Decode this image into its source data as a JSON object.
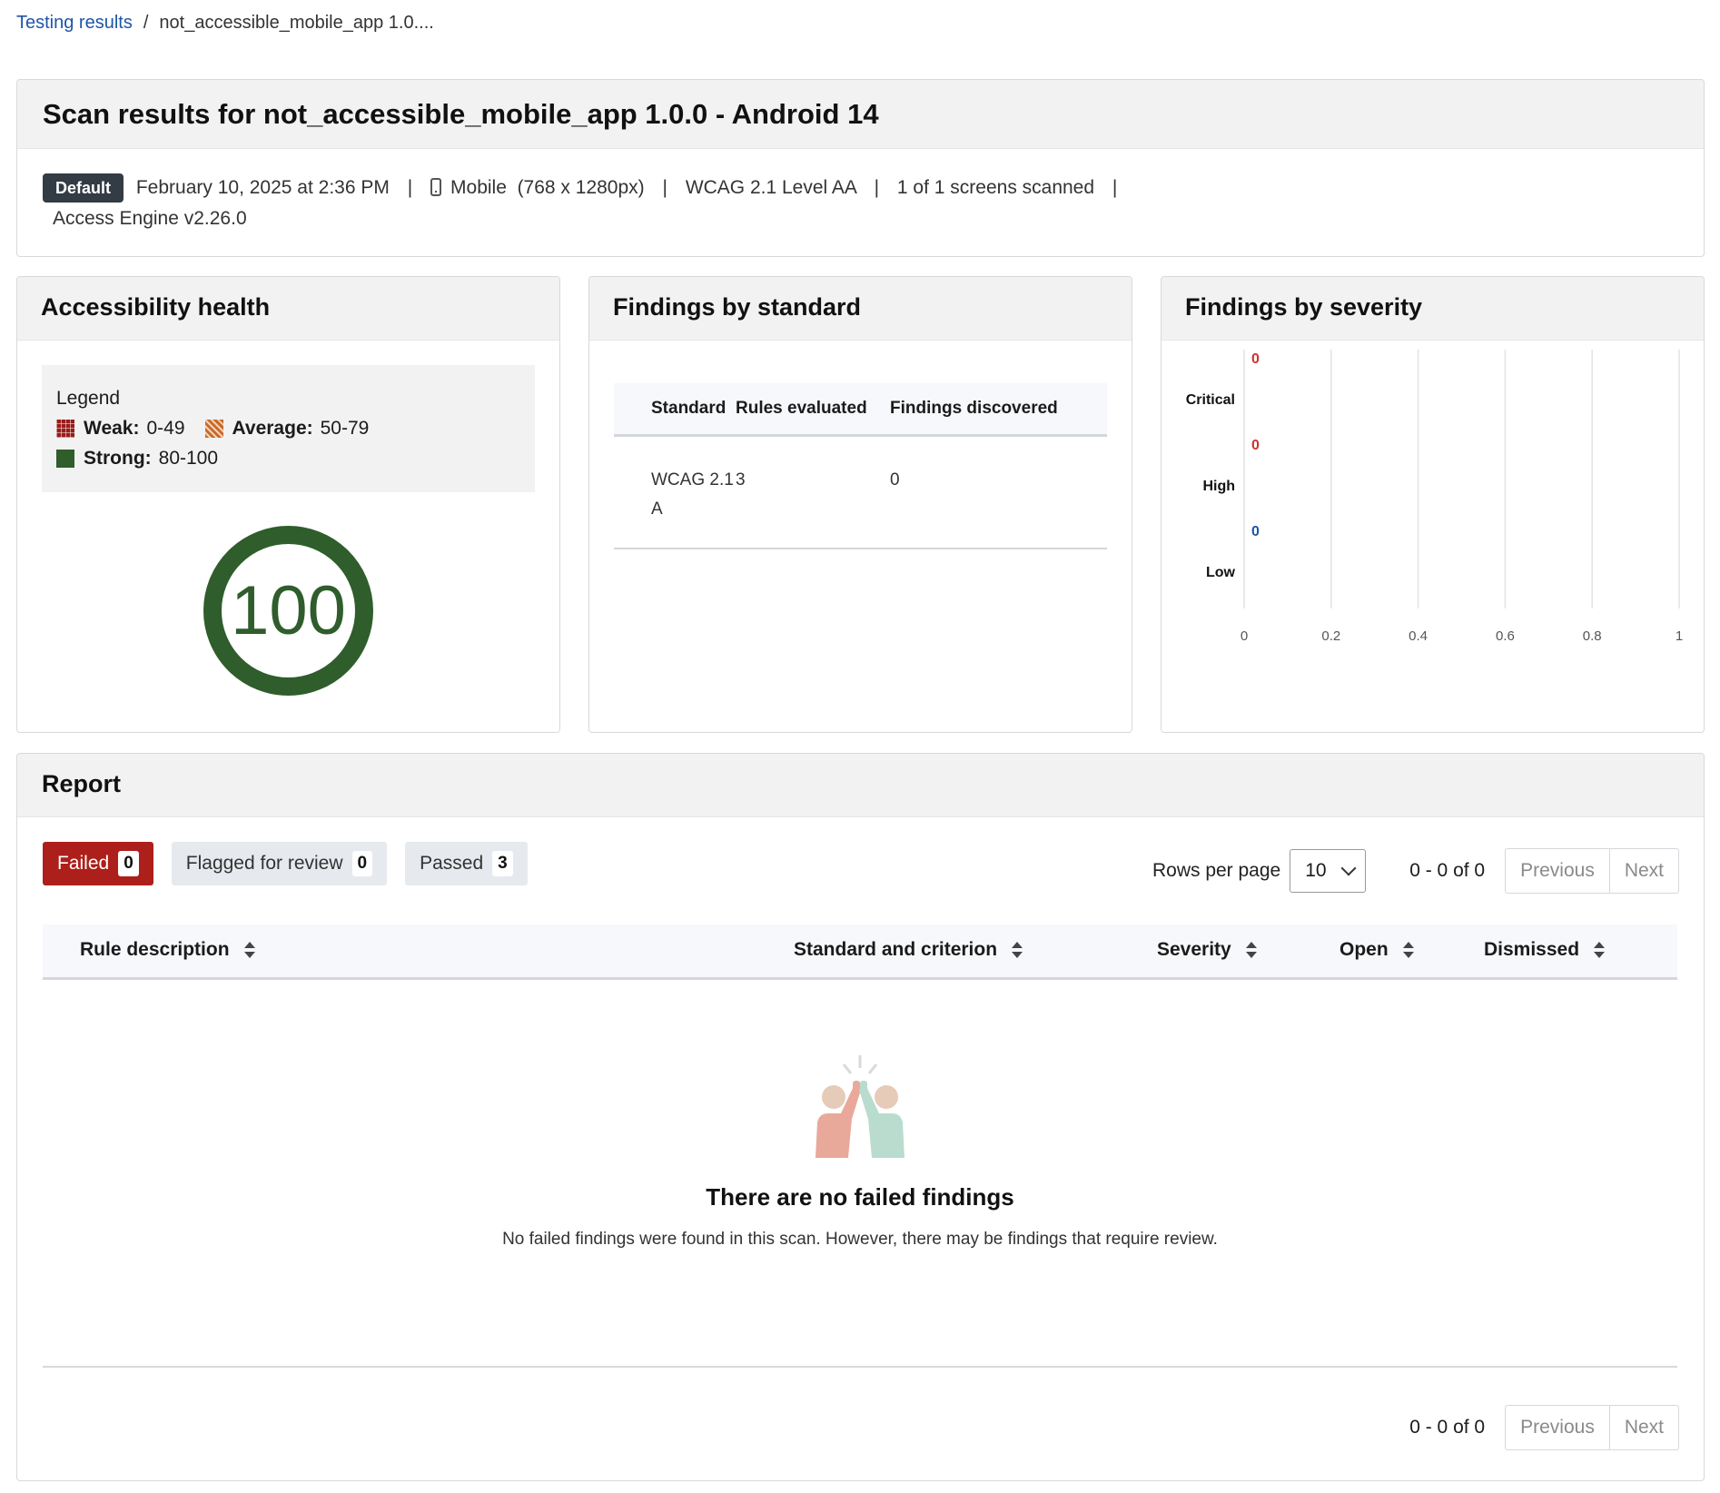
{
  "breadcrumb": {
    "link": "Testing results",
    "separator": "/",
    "current": "not_accessible_mobile_app 1.0...."
  },
  "header": {
    "title": "Scan results for not_accessible_mobile_app 1.0.0 - Android 14",
    "badge": "Default",
    "date": "February 10, 2025 at 2:36 PM",
    "device": "Mobile",
    "resolution": "(768 x 1280px)",
    "standard": "WCAG 2.1 Level AA",
    "screens": "1 of 1 screens scanned",
    "engine": "Access Engine v2.26.0",
    "separator": "|",
    "device_icon": "mobile-phone-icon"
  },
  "health": {
    "title": "Accessibility health",
    "legend_title": "Legend",
    "weak_label": "Weak:",
    "weak_range": "0-49",
    "average_label": "Average:",
    "average_range": "50-79",
    "strong_label": "Strong:",
    "strong_range": "80-100",
    "score": "100",
    "colors": {
      "weak": "#9b1b1b",
      "average": "#c76a2b",
      "strong": "#2f5d2c"
    }
  },
  "standard": {
    "title": "Findings by standard",
    "columns": [
      "Standard",
      "Rules evaluated",
      "Findings discovered"
    ],
    "rows": [
      {
        "standard": "WCAG 2.1 A",
        "rules": "3",
        "findings": "0"
      }
    ]
  },
  "severity": {
    "title": "Findings by severity"
  },
  "chart_data": {
    "type": "bar",
    "orientation": "horizontal",
    "categories": [
      "Critical",
      "High",
      "Low"
    ],
    "values": [
      0,
      0,
      0
    ],
    "value_labels": [
      "0",
      "0",
      "0"
    ],
    "value_colors": [
      "#d0312d",
      "#d0312d",
      "#1f55a8"
    ],
    "xlim": [
      0,
      1
    ],
    "xticks": [
      "0",
      "0.2",
      "0.4",
      "0.6",
      "0.8",
      "1"
    ],
    "grid": true
  },
  "report": {
    "title": "Report",
    "tabs": [
      {
        "label": "Failed",
        "count": "0",
        "active": true
      },
      {
        "label": "Flagged for review",
        "count": "0",
        "active": false
      },
      {
        "label": "Passed",
        "count": "3",
        "active": false
      }
    ],
    "rows_per_page_label": "Rows per page",
    "rows_per_page_value": "10",
    "range_text": "0 - 0 of 0",
    "previous": "Previous",
    "next": "Next",
    "columns": [
      "Rule description",
      "Standard and criterion",
      "Severity",
      "Open",
      "Dismissed"
    ],
    "empty_title": "There are no failed findings",
    "empty_text": "No failed findings were found in this scan. However, there may be findings that require review.",
    "empty_icon": "high-five-illustration-icon"
  }
}
